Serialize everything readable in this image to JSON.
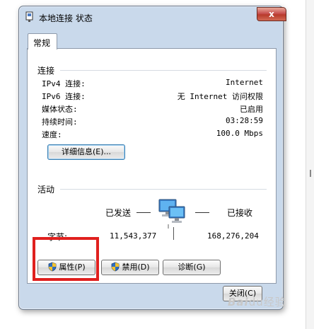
{
  "window": {
    "title": "本地连接 状态",
    "close_glyph": "x"
  },
  "tabs": [
    {
      "label": "常规",
      "selected": true
    }
  ],
  "connection": {
    "section_title": "连接",
    "rows": [
      {
        "label": "IPv4 连接:",
        "value": "Internet"
      },
      {
        "label": "IPv6 连接:",
        "value": "无 Internet 访问权限"
      },
      {
        "label": "媒体状态:",
        "value": "已启用"
      },
      {
        "label": "持续时间:",
        "value": "03:28:59"
      },
      {
        "label": "速度:",
        "value": "100.0 Mbps"
      }
    ],
    "details_button": "详细信息(E)..."
  },
  "activity": {
    "section_title": "活动",
    "sent_label": "已发送",
    "received_label": "已接收",
    "bytes_label": "字节:",
    "bytes_sent": "11,543,377",
    "bytes_received": "168,276,204"
  },
  "buttons": {
    "properties": "属性(P)",
    "disable": "禁用(D)",
    "diagnose": "诊断(G)",
    "close": "关闭(C)"
  },
  "watermark": {
    "brand": "Bai",
    "paw": "du",
    "suffix": "经验"
  },
  "colors": {
    "highlight": "#e0201e",
    "window_frame": "#c9d9eb",
    "close_button": "#c75050"
  }
}
